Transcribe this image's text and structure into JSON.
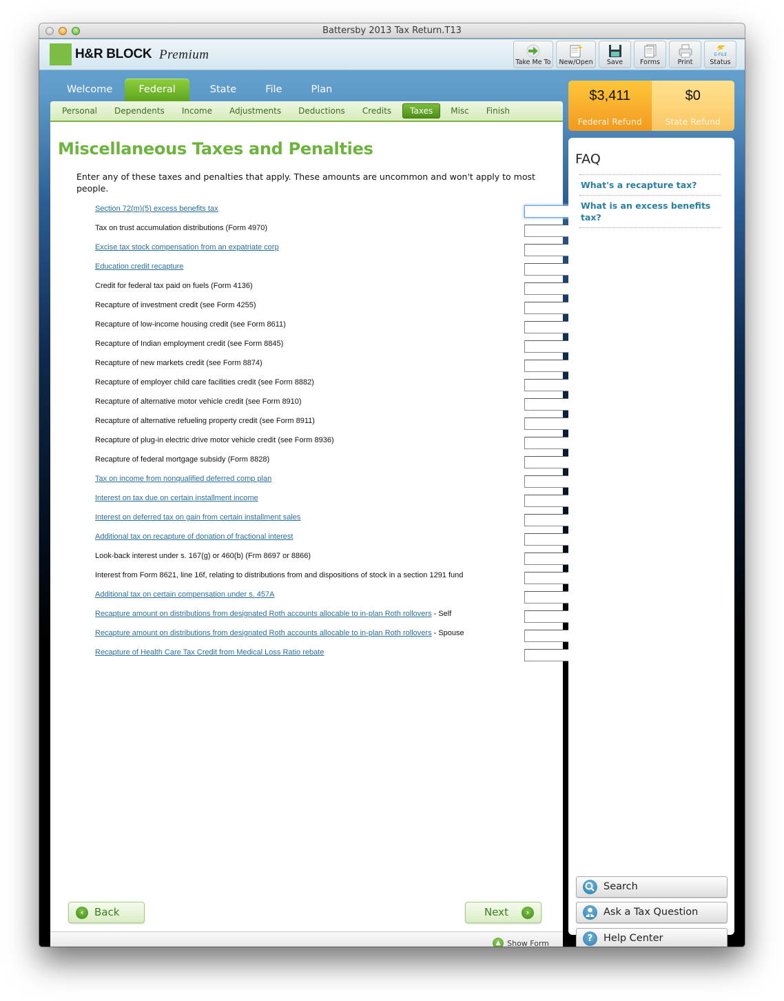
{
  "window": {
    "title": "Battersby 2013 Tax Return.T13"
  },
  "brand": {
    "name": "H&R BLOCK",
    "edition": "Premium",
    "logo_color": "#7cbd45"
  },
  "toolbar": [
    {
      "label": "Take Me To",
      "icon": "arrow-right-icon"
    },
    {
      "label": "New/Open",
      "icon": "new-document-icon"
    },
    {
      "label": "Save",
      "icon": "floppy-disk-icon"
    },
    {
      "label": "Forms",
      "icon": "forms-icon"
    },
    {
      "label": "Print",
      "icon": "printer-icon"
    },
    {
      "label": "Status",
      "icon_text": "E-FILE",
      "icon": "efile-status-icon"
    }
  ],
  "main_tabs": [
    {
      "label": "Welcome",
      "active": false
    },
    {
      "label": "Federal",
      "active": true
    },
    {
      "label": "State",
      "active": false
    },
    {
      "label": "File",
      "active": false
    },
    {
      "label": "Plan",
      "active": false
    }
  ],
  "sub_tabs": [
    {
      "label": "Personal",
      "active": false
    },
    {
      "label": "Dependents",
      "active": false
    },
    {
      "label": "Income",
      "active": false
    },
    {
      "label": "Adjustments",
      "active": false
    },
    {
      "label": "Deductions",
      "active": false
    },
    {
      "label": "Credits",
      "active": false
    },
    {
      "label": "Taxes",
      "active": true
    },
    {
      "label": "Misc",
      "active": false
    },
    {
      "label": "Finish",
      "active": false
    }
  ],
  "page": {
    "title": "Miscellaneous Taxes and Penalties",
    "intro": "Enter any of these taxes and penalties that apply. These amounts are uncommon and won't apply to most people.",
    "rows": [
      {
        "label": "Section 72(m)(5) excess benefits tax",
        "link": true,
        "suffix": "",
        "value": "",
        "focused": true
      },
      {
        "label": "Tax on trust accumulation distributions (Form 4970)",
        "link": false,
        "suffix": "",
        "value": ""
      },
      {
        "label": "Excise tax stock compensation from an expatriate corp",
        "link": true,
        "suffix": "",
        "value": ""
      },
      {
        "label": "Education credit recapture",
        "link": true,
        "suffix": "",
        "value": ""
      },
      {
        "label": "Credit for federal tax paid on fuels (Form 4136)",
        "link": false,
        "suffix": "",
        "value": ""
      },
      {
        "label": "Recapture of investment credit (see Form 4255)",
        "link": false,
        "suffix": "",
        "value": ""
      },
      {
        "label": "Recapture of low-income housing credit (see Form 8611)",
        "link": false,
        "suffix": "",
        "value": ""
      },
      {
        "label": "Recapture of Indian employment credit (see Form 8845)",
        "link": false,
        "suffix": "",
        "value": ""
      },
      {
        "label": "Recapture of new markets credit (see Form 8874)",
        "link": false,
        "suffix": "",
        "value": ""
      },
      {
        "label": "Recapture of employer child care facilities credit (see Form 8882)",
        "link": false,
        "suffix": "",
        "value": ""
      },
      {
        "label": "Recapture of alternative motor vehicle credit (see Form 8910)",
        "link": false,
        "suffix": "",
        "value": ""
      },
      {
        "label": "Recapture of alternative refueling property credit (see Form 8911)",
        "link": false,
        "suffix": "",
        "value": ""
      },
      {
        "label": "Recapture of plug-in electric drive motor vehicle credit (see Form 8936)",
        "link": false,
        "suffix": "",
        "value": ""
      },
      {
        "label": "Recapture of federal mortgage subsidy (Form 8828)",
        "link": false,
        "suffix": "",
        "value": ""
      },
      {
        "label": "Tax on income from nonqualified deferred comp plan",
        "link": true,
        "suffix": "",
        "value": ""
      },
      {
        "label": "Interest on tax due on certain installment income",
        "link": true,
        "suffix": "",
        "value": ""
      },
      {
        "label": "Interest on deferred tax on gain from certain installment sales",
        "link": true,
        "suffix": "",
        "value": ""
      },
      {
        "label": "Additional tax on recapture of donation of fractional interest",
        "link": true,
        "suffix": "",
        "value": ""
      },
      {
        "label": "Look-back interest under s. 167(g) or 460(b) (Frm 8697 or 8866)",
        "link": false,
        "suffix": "",
        "value": ""
      },
      {
        "label": "Interest from Form 8621, line 16f, relating to distributions from and dispositions of stock in a section 1291 fund",
        "link": false,
        "suffix": "",
        "value": ""
      },
      {
        "label": "Additional tax on certain compensation under s. 457A",
        "link": true,
        "suffix": "",
        "value": ""
      },
      {
        "label": "Recapture amount on distributions from designated Roth accounts allocable to in-plan Roth rollovers",
        "link": true,
        "suffix": " - Self",
        "value": ""
      },
      {
        "label": "Recapture amount on distributions from designated Roth accounts allocable to in-plan Roth rollovers",
        "link": true,
        "suffix": " - Spouse",
        "value": ""
      },
      {
        "label": "Recapture of Health Care Tax Credit from Medical Loss Ratio rebate",
        "link": true,
        "suffix": "",
        "value": ""
      }
    ]
  },
  "nav": {
    "back": "Back",
    "next": "Next",
    "show_form": "Show Form"
  },
  "refund": {
    "federal_amount": "$3,411",
    "federal_label": "Federal Refund",
    "state_amount": "$0",
    "state_label": "State Refund"
  },
  "faq": {
    "title": "FAQ",
    "items": [
      "What's a recapture tax?",
      "What is an excess benefits tax?"
    ]
  },
  "help": [
    {
      "label": "Search",
      "icon": "search-icon",
      "glyph": "⚲"
    },
    {
      "label": "Ask a Tax Question",
      "icon": "person-icon",
      "glyph": "👤"
    },
    {
      "label": "Help Center",
      "icon": "question-icon",
      "glyph": "?"
    }
  ]
}
